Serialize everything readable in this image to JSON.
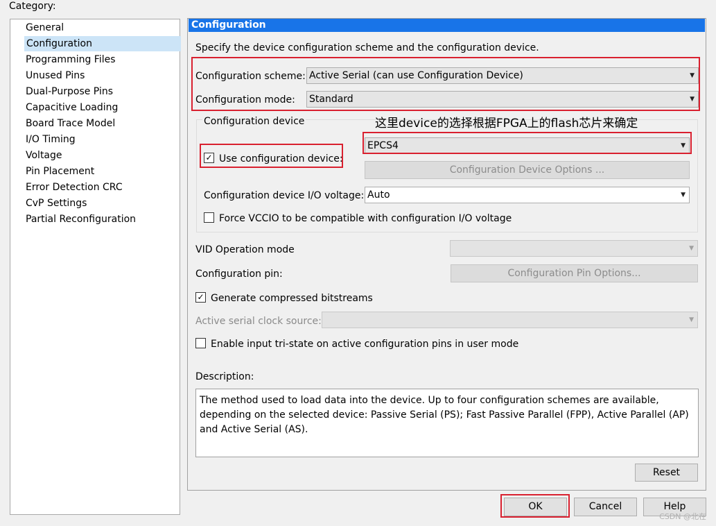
{
  "category": {
    "label": "Category:",
    "items": [
      {
        "label": "General"
      },
      {
        "label": "Configuration",
        "selected": true
      },
      {
        "label": "Programming Files"
      },
      {
        "label": "Unused Pins"
      },
      {
        "label": "Dual-Purpose Pins"
      },
      {
        "label": "Capacitive Loading"
      },
      {
        "label": "Board Trace Model"
      },
      {
        "label": "I/O Timing"
      },
      {
        "label": "Voltage"
      },
      {
        "label": "Pin Placement"
      },
      {
        "label": "Error Detection CRC"
      },
      {
        "label": "CvP Settings"
      },
      {
        "label": "Partial Reconfiguration"
      }
    ]
  },
  "panel": {
    "title": "Configuration",
    "intro": "Specify the device configuration scheme and the configuration device.",
    "scheme_label": "Configuration scheme:",
    "scheme_value": "Active Serial (can use Configuration Device)",
    "mode_label": "Configuration mode:",
    "mode_value": "Standard",
    "device_group_title": "Configuration device",
    "annotation": "这里device的选择根据FPGA上的flash芯片来确定",
    "use_device_label": "Use configuration device:",
    "use_device_checked": true,
    "device_value": "EPCS4",
    "device_options_button": "Configuration Device Options ...",
    "io_voltage_label": "Configuration device I/O voltage:",
    "io_voltage_value": "Auto",
    "force_vccio_label": "Force VCCIO to be compatible with configuration I/O voltage",
    "force_vccio_checked": false,
    "vid_label": "VID Operation mode",
    "config_pin_label": "Configuration pin:",
    "config_pin_button": "Configuration Pin Options...",
    "compressed_label": "Generate compressed bitstreams",
    "compressed_checked": true,
    "clock_source_label": "Active serial clock source:",
    "tristate_label": "Enable input tri-state on active configuration pins in user mode",
    "tristate_checked": false,
    "description_label": "Description:",
    "description_text": "The method used to load data into the device. Up to four configuration schemes are available, depending on the selected device: Passive Serial (PS); Fast Passive Parallel (FPP), Active Parallel (AP) and Active Serial (AS).",
    "reset_button": "Reset"
  },
  "footer": {
    "ok": "OK",
    "cancel": "Cancel",
    "help": "Help",
    "watermark": "CSDN @北在"
  },
  "icons": {
    "check": "✓",
    "dropdown": "▼"
  },
  "colors": {
    "header_bg": "#1874e8",
    "selection_bg": "#cce4f7",
    "annotation_red": "#d9202f"
  }
}
